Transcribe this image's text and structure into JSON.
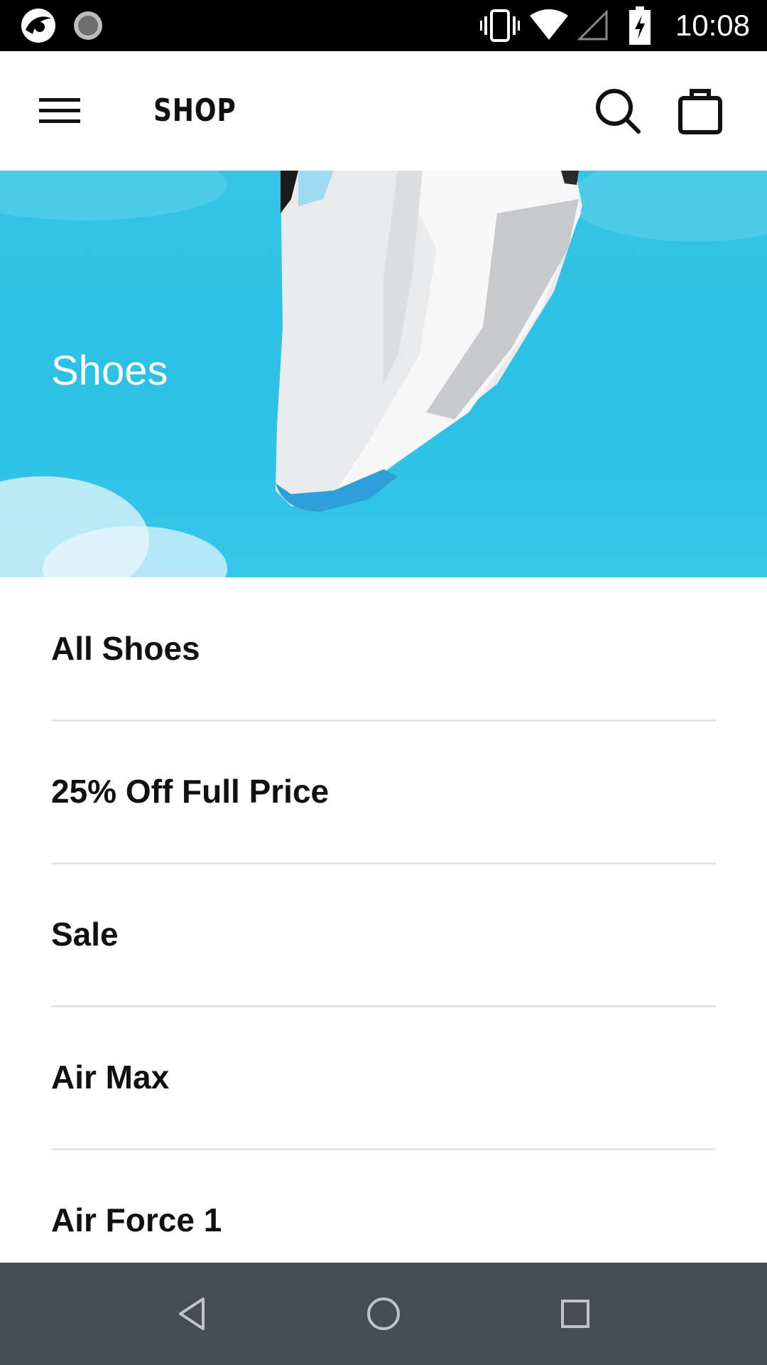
{
  "status_bar": {
    "time": "10:08",
    "icons": [
      "app-notification-icon",
      "sync-icon",
      "vibrate-icon",
      "wifi-icon",
      "signal-icon",
      "battery-charging-icon"
    ]
  },
  "app_bar": {
    "title": "SHOP",
    "menu_icon": "hamburger-menu-icon",
    "search_icon": "search-icon",
    "bag_icon": "shopping-bag-icon"
  },
  "hero": {
    "title": "Shoes",
    "image": "sneaker-hero-image",
    "background_color": "#2cc0e5"
  },
  "categories": [
    {
      "label": "All Shoes"
    },
    {
      "label": "25% Off Full Price"
    },
    {
      "label": "Sale"
    },
    {
      "label": "Air Max"
    },
    {
      "label": "Air Force 1"
    }
  ],
  "nav_bar": {
    "back_icon": "back-triangle-icon",
    "home_icon": "home-circle-icon",
    "recents_icon": "recents-square-icon"
  }
}
